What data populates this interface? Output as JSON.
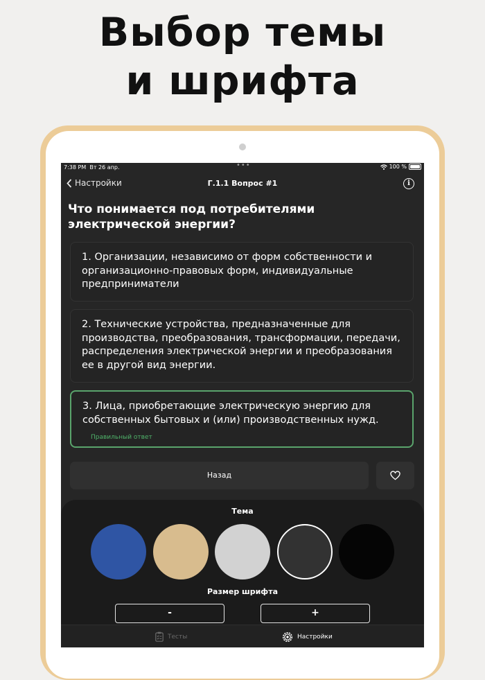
{
  "headline": {
    "line1": "Выбор темы",
    "line2": "и шрифта"
  },
  "status_bar": {
    "time": "7:38 PM",
    "date": "Вт 26 апр.",
    "battery": "100 %"
  },
  "nav": {
    "back_label": "Настройки",
    "title": "Г.1.1 Вопрос #1",
    "info_icon": "info-icon"
  },
  "question": "Что понимается под потребителями электрической энергии?",
  "answers": [
    {
      "text": "1. Организации, независимо от форм собственности и организационно-правовых форм, индивидуальные предприниматели",
      "correct": false
    },
    {
      "text": "2. Технические устройства, предназначенные для производства, преобразования, трансформации, передачи, распределения электрической энергии и преобразования ее в другой вид энергии.",
      "correct": false
    },
    {
      "text": "3. Лица, приобретающие электрическую энергию для собственных бытовых и (или) производственных нужд.",
      "correct": true,
      "note": "Правильный ответ"
    }
  ],
  "actions": {
    "back_label": "Назад",
    "favorite_icon": "heart-icon"
  },
  "settings": {
    "theme_title": "Тема",
    "themes": [
      {
        "name": "blue",
        "color": "#2f55a4"
      },
      {
        "name": "beige",
        "color": "#d8bc8e"
      },
      {
        "name": "light-gray",
        "color": "#d2d2d2"
      },
      {
        "name": "dark-gray",
        "color": "#323232",
        "selected": true
      },
      {
        "name": "black",
        "color": "#050505"
      }
    ],
    "font_size_title": "Размер шрифта",
    "decrease_label": "-",
    "increase_label": "+"
  },
  "tabs": [
    {
      "label": "Тесты",
      "icon": "clipboard-icon",
      "active": false
    },
    {
      "label": "Настройки",
      "icon": "gear-icon",
      "active": true
    }
  ],
  "colors": {
    "page_bg": "#f1f0ee",
    "tablet_frame": "#eccc98",
    "screen_bg": "#262626",
    "correct_accent": "#5aa46c"
  }
}
